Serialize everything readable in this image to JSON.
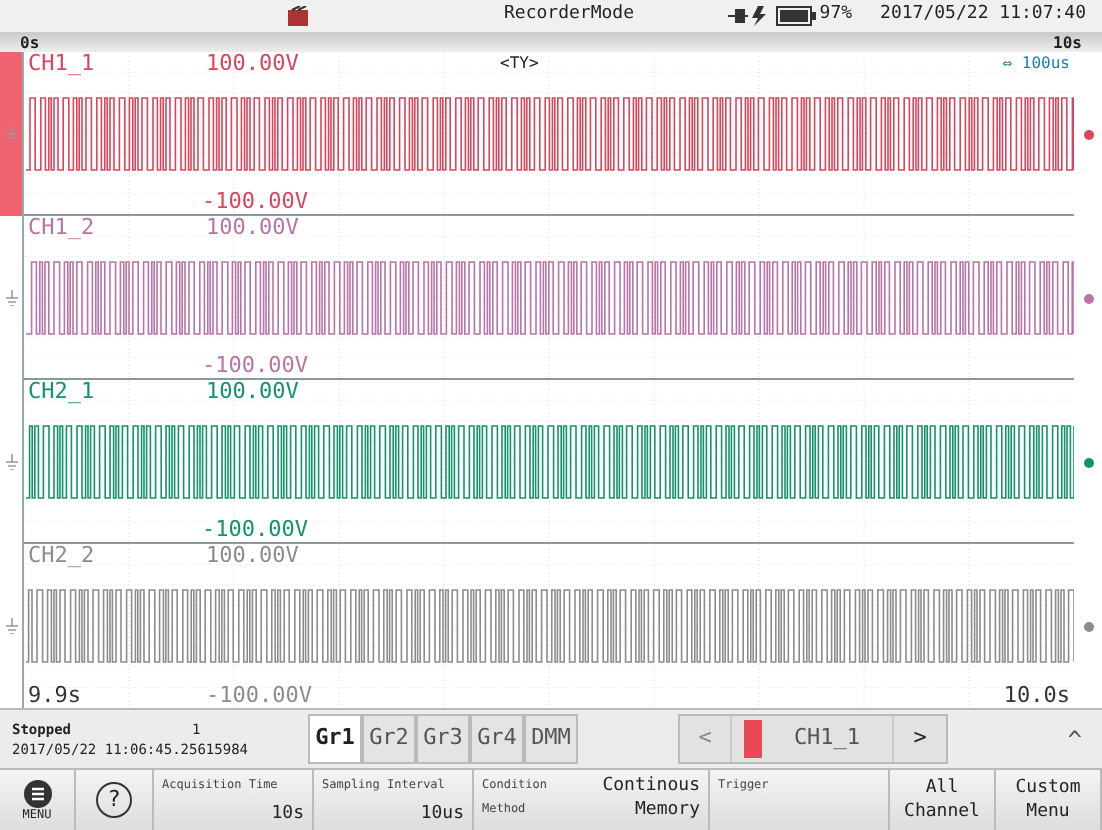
{
  "status_bar": {
    "mode": "RecorderMode",
    "battery": "97%",
    "datetime": "2017/05/22 11:07:40"
  },
  "time_axis": {
    "start": "0s",
    "end": "10s"
  },
  "zoom_info": {
    "trigger_mark": "<TY>",
    "time_div": "⇔ 100us"
  },
  "channels": [
    {
      "name": "CH1_1",
      "top": "100.00V",
      "bottom": "-100.00V",
      "color": "#d9455a",
      "selected": true
    },
    {
      "name": "CH1_2",
      "top": "100.00V",
      "bottom": "-100.00V",
      "color": "#b873a8",
      "selected": false
    },
    {
      "name": "CH2_1",
      "top": "100.00V",
      "bottom": "-100.00V",
      "color": "#13936a",
      "selected": false
    },
    {
      "name": "CH2_2",
      "top": "100.00V",
      "bottom": "-100.00V",
      "color": "#8c8c8c",
      "selected": false
    }
  ],
  "view_range": {
    "start": "9.9s",
    "end": "10.0s"
  },
  "state": {
    "status": "Stopped",
    "count": "1",
    "timestamp": "2017/05/22 11:06:45.25615984"
  },
  "groups": [
    {
      "label": "Gr1",
      "selected": true
    },
    {
      "label": "Gr2",
      "selected": false
    },
    {
      "label": "Gr3",
      "selected": false
    },
    {
      "label": "Gr4",
      "selected": false
    },
    {
      "label": "DMM",
      "selected": false
    }
  ],
  "channel_selector": {
    "prev": "<",
    "current": "CH1_1",
    "color": "#e84a55",
    "next": ">"
  },
  "collapse": "^",
  "menu_label": "MENU",
  "help": "?",
  "settings": [
    {
      "label": "Acquisition Time",
      "value": "10s"
    },
    {
      "label": "Sampling Interval",
      "value": "10us"
    },
    {
      "label": "Condition",
      "sublabel": "Method",
      "value": "Continous Memory"
    },
    {
      "label": "Trigger"
    }
  ],
  "buttons": [
    "All Channel",
    "Custom Menu"
  ]
}
